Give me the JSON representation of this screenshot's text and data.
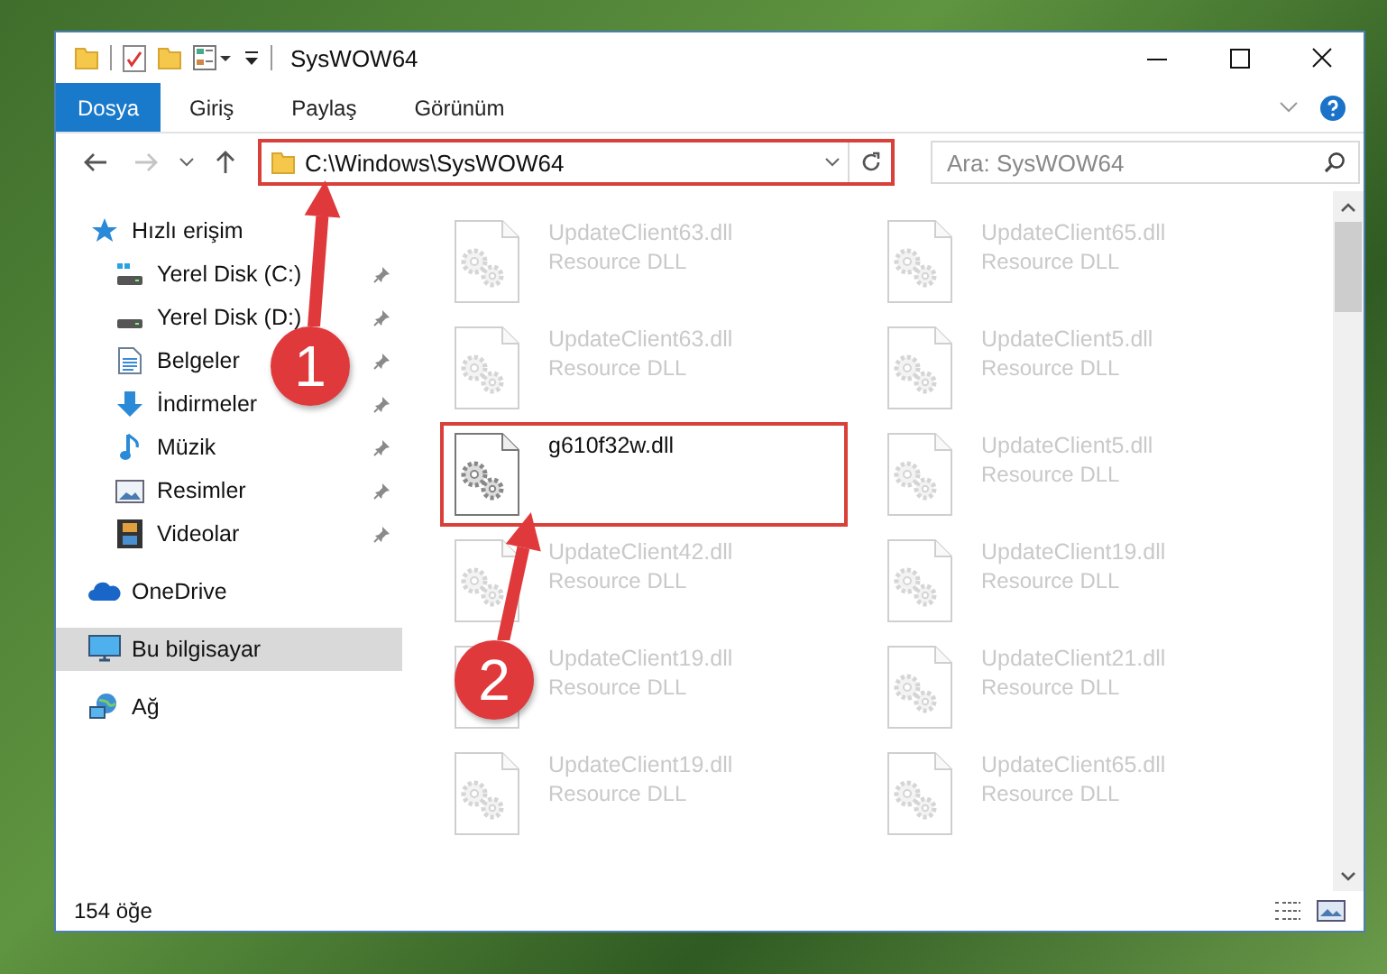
{
  "window": {
    "title": "SysWOW64"
  },
  "ribbon_tabs": [
    {
      "label": "Dosya",
      "selected": true
    },
    {
      "label": "Giriş",
      "selected": false
    },
    {
      "label": "Paylaş",
      "selected": false
    },
    {
      "label": "Görünüm",
      "selected": false
    }
  ],
  "address_bar": {
    "path": "C:\\Windows\\SysWOW64",
    "highlighted": true
  },
  "search": {
    "placeholder": "Ara: SysWOW64"
  },
  "navigation": [
    {
      "label": "Hızlı erişim",
      "kind": "star",
      "selected": false,
      "children": [
        {
          "label": "Yerel Disk (C:)",
          "kind": "system-drive",
          "pinned": true,
          "selected": false
        },
        {
          "label": "Yerel Disk (D:)",
          "kind": "drive",
          "pinned": true,
          "selected": false
        },
        {
          "label": "Belgeler",
          "kind": "documents",
          "pinned": true,
          "selected": false
        },
        {
          "label": "İndirmeler",
          "kind": "downloads",
          "pinned": true,
          "selected": false
        },
        {
          "label": "Müzik",
          "kind": "music",
          "pinned": true,
          "selected": false
        },
        {
          "label": "Resimler",
          "kind": "pictures",
          "pinned": true,
          "selected": false
        },
        {
          "label": "Videolar",
          "kind": "videos",
          "pinned": true,
          "selected": false
        }
      ]
    },
    {
      "label": "OneDrive",
      "kind": "cloud",
      "selected": false
    },
    {
      "label": "Bu bilgisayar",
      "kind": "computer",
      "selected": true
    },
    {
      "label": "Ağ",
      "kind": "network",
      "selected": false
    }
  ],
  "files": [
    {
      "name": "UpdateClient63.dll",
      "type": "Resource DLL",
      "dimmed": true,
      "highlighted": false
    },
    {
      "name": "UpdateClient65.dll",
      "type": "Resource DLL",
      "dimmed": true,
      "highlighted": false
    },
    {
      "name": "UpdateClient63.dll",
      "type": "Resource DLL",
      "dimmed": true,
      "highlighted": false
    },
    {
      "name": "UpdateClient5.dll",
      "type": "Resource DLL",
      "dimmed": true,
      "highlighted": false
    },
    {
      "name": "g610f32w.dll",
      "dimmed": false,
      "highlighted": true
    },
    {
      "name": "UpdateClient5.dll",
      "type": "Resource DLL",
      "dimmed": true,
      "highlighted": false
    },
    {
      "name": "UpdateClient42.dll",
      "type": "Resource DLL",
      "dimmed": true,
      "highlighted": false
    },
    {
      "name": "UpdateClient19.dll",
      "type": "Resource DLL",
      "dimmed": true,
      "highlighted": false
    },
    {
      "name": "UpdateClient19.dll",
      "type": "Resource DLL",
      "dimmed": true,
      "highlighted": false
    },
    {
      "name": "UpdateClient21.dll",
      "type": "Resource DLL",
      "dimmed": true,
      "highlighted": false
    },
    {
      "name": "UpdateClient19.dll",
      "type": "Resource DLL",
      "dimmed": true,
      "highlighted": false
    },
    {
      "name": "UpdateClient65.dll",
      "type": "Resource DLL",
      "dimmed": true,
      "highlighted": false
    }
  ],
  "status_bar": {
    "item_count": "154 öğe"
  },
  "callouts": [
    {
      "number": "1"
    },
    {
      "number": "2"
    }
  ]
}
